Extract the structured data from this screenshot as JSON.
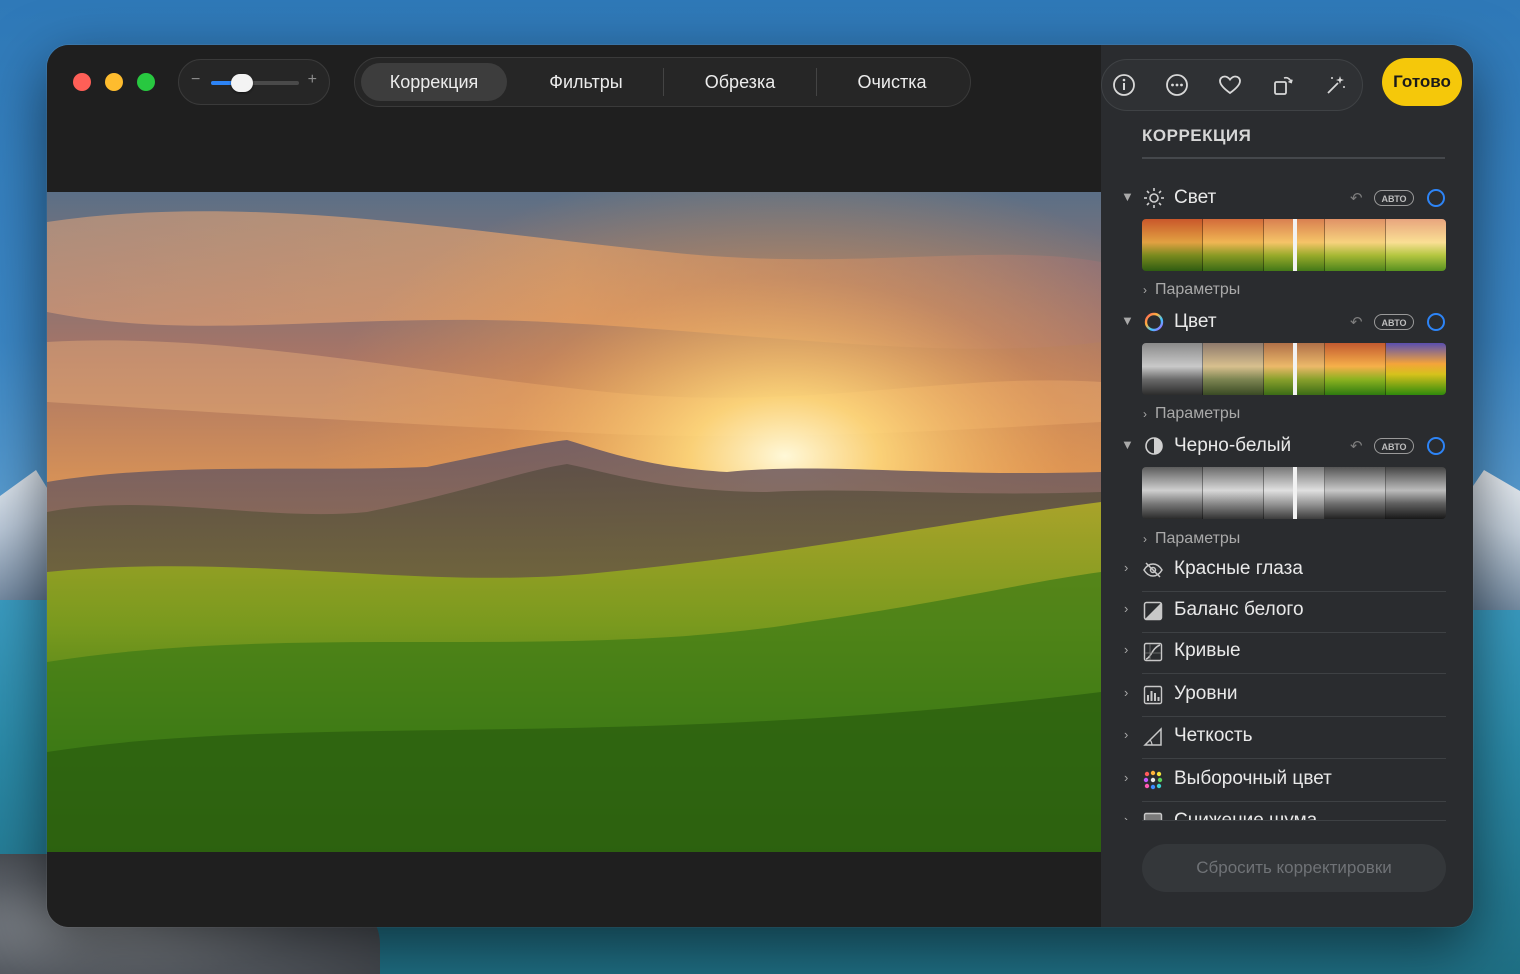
{
  "window": {
    "traffic_lights": [
      "close",
      "minimize",
      "zoom"
    ],
    "zoom_slider": {
      "minus_label": "−",
      "plus_label": "+",
      "value": 0.35
    }
  },
  "tabs": [
    {
      "label": "Коррекция",
      "active": true
    },
    {
      "label": "Фильтры",
      "active": false
    },
    {
      "label": "Обрезка",
      "active": false
    },
    {
      "label": "Очистка",
      "active": false
    }
  ],
  "toolbar": {
    "icons": [
      "info-icon",
      "more-icon",
      "heart-icon",
      "rotate-icon",
      "magic-wand-icon"
    ],
    "done_label": "Готово"
  },
  "sidebar": {
    "title": "КОРРЕКЦИЯ",
    "adjustments": [
      {
        "label": "Свет",
        "icon": "sun-icon",
        "auto_label": "АВТО",
        "params_label": "Параметры",
        "strip": "color"
      },
      {
        "label": "Цвет",
        "icon": "color-circle-icon",
        "auto_label": "АВТО",
        "params_label": "Параметры",
        "strip": "saturation"
      },
      {
        "label": "Черно-белый",
        "icon": "half-circle-icon",
        "auto_label": "АВТО",
        "params_label": "Параметры",
        "strip": "mono"
      }
    ],
    "tools": [
      {
        "label": "Красные глаза",
        "icon": "eye-slash-icon"
      },
      {
        "label": "Баланс белого",
        "icon": "white-balance-icon"
      },
      {
        "label": "Кривые",
        "icon": "curves-icon"
      },
      {
        "label": "Уровни",
        "icon": "levels-icon"
      },
      {
        "label": "Четкость",
        "icon": "sharpness-icon"
      },
      {
        "label": "Выборочный цвет",
        "icon": "selective-color-icon"
      },
      {
        "label": "Снижение шума",
        "icon": "noise-reduction-icon"
      }
    ],
    "reset_label": "Сбросить корректировки"
  },
  "colors": {
    "accent_blue": "#2d84f6",
    "done_yellow": "#f5c80a",
    "sidebar_bg": "#2a2c2f",
    "window_bg": "#1f1f1f"
  }
}
